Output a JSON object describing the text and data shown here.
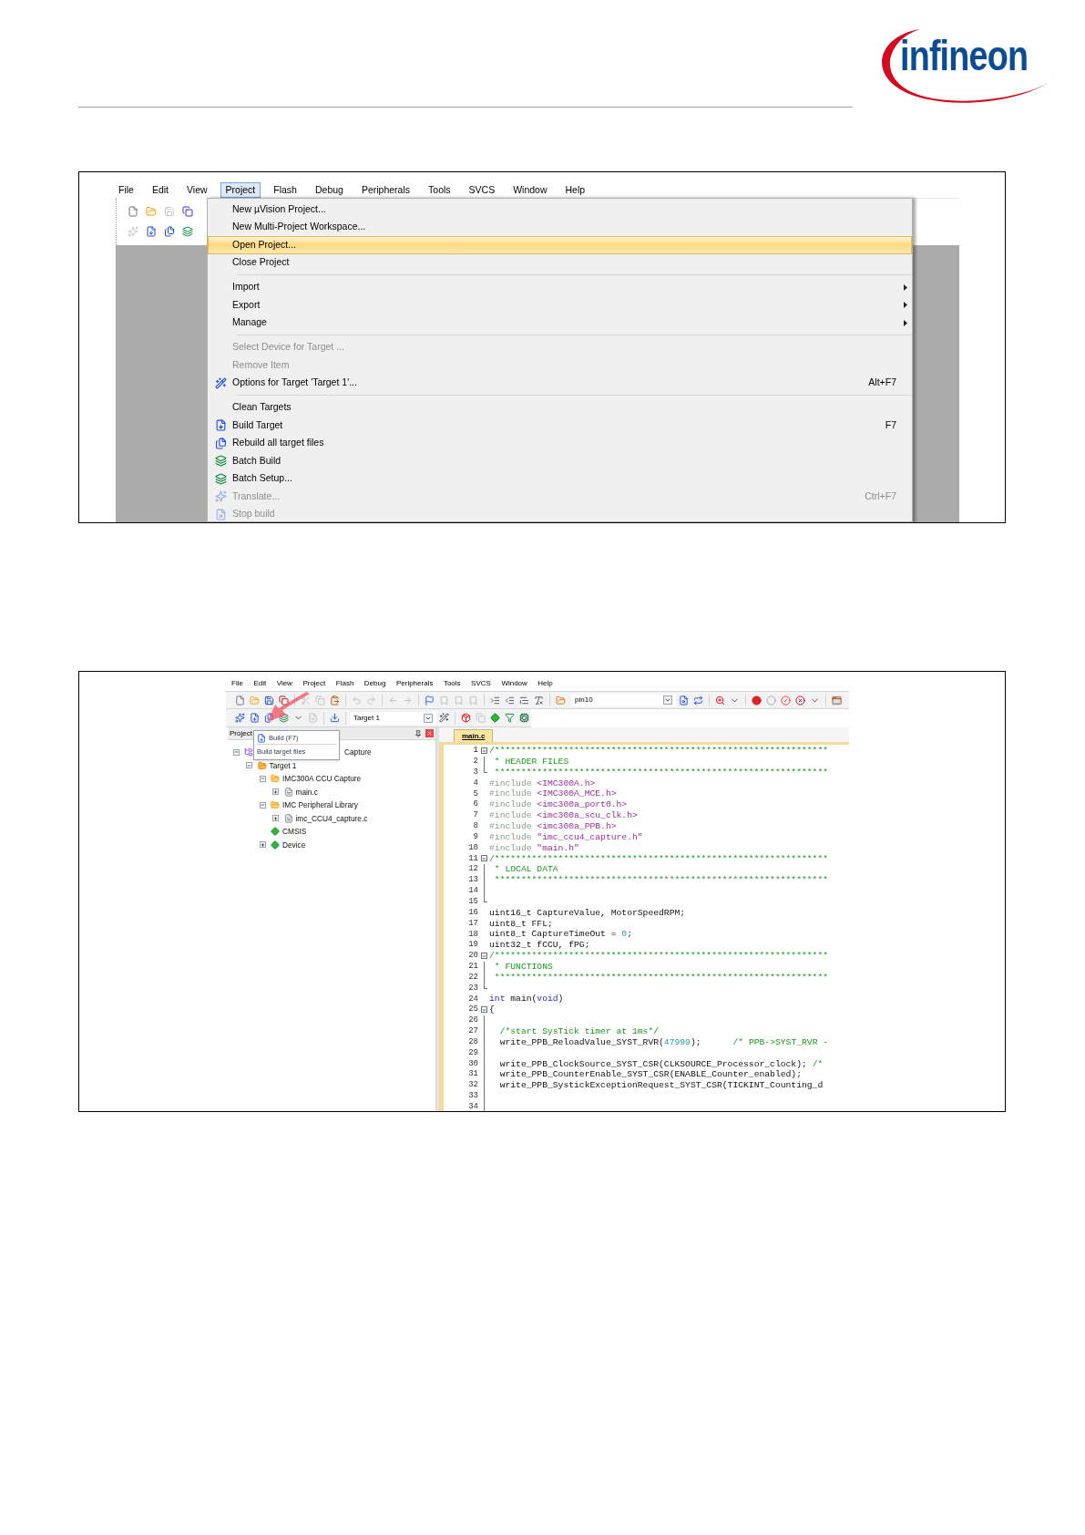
{
  "logo": {
    "text": "infineon"
  },
  "screenshot_1": {
    "menubar": [
      {
        "label": "File",
        "selected": false
      },
      {
        "label": "Edit",
        "selected": false
      },
      {
        "label": "View",
        "selected": false
      },
      {
        "label": "Project",
        "selected": true
      },
      {
        "label": "Flash",
        "selected": false
      },
      {
        "label": "Debug",
        "selected": false
      },
      {
        "label": "Peripherals",
        "selected": false
      },
      {
        "label": "Tools",
        "selected": false
      },
      {
        "label": "SVCS",
        "selected": false
      },
      {
        "label": "Window",
        "selected": false
      },
      {
        "label": "Help",
        "selected": false
      }
    ],
    "menu": [
      {
        "kind": "item",
        "label": "New µVision Project...",
        "selected": false,
        "disabled": false,
        "submenu": false
      },
      {
        "kind": "item",
        "label": "New Multi-Project Workspace...",
        "selected": false,
        "disabled": false,
        "submenu": false
      },
      {
        "kind": "item",
        "label": "Open Project...",
        "selected": true,
        "disabled": false,
        "submenu": false
      },
      {
        "kind": "item",
        "label": "Close Project",
        "selected": false,
        "disabled": false,
        "submenu": false
      },
      {
        "kind": "separator"
      },
      {
        "kind": "item",
        "label": "Import",
        "selected": false,
        "disabled": false,
        "submenu": true
      },
      {
        "kind": "item",
        "label": "Export",
        "selected": false,
        "disabled": false,
        "submenu": true
      },
      {
        "kind": "item",
        "label": "Manage",
        "selected": false,
        "disabled": false,
        "submenu": true
      },
      {
        "kind": "separator"
      },
      {
        "kind": "item",
        "label": "Select Device for Target ...",
        "selected": false,
        "disabled": true,
        "submenu": false
      },
      {
        "kind": "item",
        "label": "Remove Item",
        "selected": false,
        "disabled": true,
        "submenu": false
      },
      {
        "kind": "item",
        "label": "Options for Target 'Target 1'...",
        "shortcut": "Alt+F7",
        "selected": false,
        "disabled": false,
        "submenu": false
      },
      {
        "kind": "separator"
      },
      {
        "kind": "item",
        "label": "Clean Targets",
        "selected": false,
        "disabled": false,
        "submenu": false
      },
      {
        "kind": "item",
        "label": "Build Target",
        "shortcut": "F7",
        "selected": false,
        "disabled": false,
        "submenu": false
      },
      {
        "kind": "item",
        "label": "Rebuild all target files",
        "selected": false,
        "disabled": false,
        "submenu": false
      },
      {
        "kind": "item",
        "label": "Batch Build",
        "selected": false,
        "disabled": false,
        "submenu": false
      },
      {
        "kind": "item",
        "label": "Batch Setup...",
        "selected": false,
        "disabled": false,
        "submenu": false
      },
      {
        "kind": "item",
        "label": "Translate...",
        "shortcut": "Ctrl+F7",
        "selected": false,
        "disabled": true,
        "submenu": false
      },
      {
        "kind": "item",
        "label": "Stop build",
        "selected": false,
        "disabled": true,
        "submenu": false
      }
    ]
  },
  "screenshot_2": {
    "menubar": [
      "File",
      "Edit",
      "View",
      "Project",
      "Flash",
      "Debug",
      "Peripherals",
      "Tools",
      "SVCS",
      "Window",
      "Help"
    ],
    "toolbar": {
      "configuration": "pin10",
      "target": "Target 1"
    },
    "tooltip": {
      "title": "Build (F7)",
      "description": "Build target files"
    },
    "project_panel": {
      "title": "Project",
      "tree": [
        {
          "label": "Capture",
          "kind": "project",
          "expandable": true,
          "expanded": true,
          "children": [
            {
              "label": "Target 1",
              "kind": "target",
              "expandable": true,
              "expanded": true,
              "children": [
                {
                  "label": "IMC300A CCU Capture",
                  "kind": "folder",
                  "expandable": true,
                  "expanded": true,
                  "children": [
                    {
                      "label": "main.c",
                      "kind": "file",
                      "expandable": true,
                      "expanded": false
                    }
                  ]
                },
                {
                  "label": "IMC Peripheral Library",
                  "kind": "folder",
                  "expandable": true,
                  "expanded": true,
                  "children": [
                    {
                      "label": "imc_CCU4_capture.c",
                      "kind": "file",
                      "expandable": true,
                      "expanded": false
                    }
                  ]
                },
                {
                  "label": "CMSIS",
                  "kind": "component",
                  "expandable": false,
                  "expanded": false
                },
                {
                  "label": "Device",
                  "kind": "component",
                  "expandable": true,
                  "expanded": false
                }
              ]
            }
          ]
        }
      ]
    },
    "editor": {
      "tab": "main.c",
      "lines": [
        {
          "number": "1",
          "kind": "open",
          "parts": [
            {
              "kind": "comment",
              "text": "/***************************************************************"
            }
          ]
        },
        {
          "number": "2",
          "kind": "inner",
          "parts": [
            {
              "kind": "comment",
              "text": " * HEADER FILES"
            }
          ]
        },
        {
          "number": "3",
          "kind": "close",
          "parts": [
            {
              "kind": "comment",
              "text": " ***************************************************************"
            }
          ]
        },
        {
          "number": "4",
          "kind": "plain",
          "parts": [
            {
              "kind": "directive",
              "text": "#include "
            },
            {
              "kind": "string",
              "text": "<IMC300A.h>"
            }
          ]
        },
        {
          "number": "5",
          "kind": "plain",
          "parts": [
            {
              "kind": "directive",
              "text": "#include "
            },
            {
              "kind": "string",
              "text": "<IMC300A_MCE.h>"
            }
          ]
        },
        {
          "number": "6",
          "kind": "plain",
          "parts": [
            {
              "kind": "directive",
              "text": "#include "
            },
            {
              "kind": "string",
              "text": "<imc300a_port0.h>"
            }
          ]
        },
        {
          "number": "7",
          "kind": "plain",
          "parts": [
            {
              "kind": "directive",
              "text": "#include "
            },
            {
              "kind": "string",
              "text": "<imc300a_scu_clk.h>"
            }
          ]
        },
        {
          "number": "8",
          "kind": "plain",
          "parts": [
            {
              "kind": "directive",
              "text": "#include "
            },
            {
              "kind": "string",
              "text": "<imc300a_PPB.h>"
            }
          ]
        },
        {
          "number": "9",
          "kind": "plain",
          "parts": [
            {
              "kind": "directive",
              "text": "#include "
            },
            {
              "kind": "string",
              "text": "\"imc_ccu4_capture.h\""
            }
          ]
        },
        {
          "number": "10",
          "kind": "plain",
          "parts": [
            {
              "kind": "directive",
              "text": "#include "
            },
            {
              "kind": "string",
              "text": "\"main.h\""
            }
          ]
        },
        {
          "number": "11",
          "kind": "open",
          "parts": [
            {
              "kind": "comment",
              "text": "/***************************************************************"
            }
          ]
        },
        {
          "number": "12",
          "kind": "inner",
          "parts": [
            {
              "kind": "comment",
              "text": " * LOCAL DATA"
            }
          ]
        },
        {
          "number": "13",
          "kind": "inner",
          "parts": [
            {
              "kind": "comment",
              "text": " ***************************************************************"
            }
          ]
        },
        {
          "number": "14",
          "kind": "inner"
        },
        {
          "number": "15",
          "kind": "close"
        },
        {
          "number": "16",
          "kind": "plain",
          "parts": [
            {
              "kind": "plain",
              "text": "uint16_t CaptureValue, MotorSpeedRPM;"
            }
          ]
        },
        {
          "number": "17",
          "kind": "plain",
          "parts": [
            {
              "kind": "plain",
              "text": "uint8_t FFL;"
            }
          ]
        },
        {
          "number": "18",
          "kind": "plain",
          "parts": [
            {
              "kind": "plain",
              "text": "uint8_t CaptureTimeOut = "
            },
            {
              "kind": "number",
              "text": "0"
            },
            {
              "kind": "plain",
              "text": ";"
            }
          ]
        },
        {
          "number": "19",
          "kind": "plain",
          "parts": [
            {
              "kind": "plain",
              "text": "uint32_t fCCU, fPG;"
            }
          ]
        },
        {
          "number": "20",
          "kind": "open",
          "parts": [
            {
              "kind": "comment",
              "text": "/***************************************************************"
            }
          ]
        },
        {
          "number": "21",
          "kind": "inner",
          "parts": [
            {
              "kind": "comment",
              "text": " * FUNCTIONS"
            }
          ]
        },
        {
          "number": "22",
          "kind": "inner",
          "parts": [
            {
              "kind": "comment",
              "text": " ***************************************************************"
            }
          ]
        },
        {
          "number": "23",
          "kind": "close"
        },
        {
          "number": "24",
          "kind": "plain",
          "parts": [
            {
              "kind": "keyword",
              "text": "int"
            },
            {
              "kind": "plain",
              "text": " main("
            },
            {
              "kind": "keyword",
              "text": "void"
            },
            {
              "kind": "plain",
              "text": ")"
            }
          ]
        },
        {
          "number": "25",
          "kind": "open",
          "parts": [
            {
              "kind": "plain",
              "text": "{"
            }
          ]
        },
        {
          "number": "26",
          "kind": "inner"
        },
        {
          "number": "27",
          "kind": "inner",
          "parts": [
            {
              "kind": "comment",
              "text": "  /*start SysTick timer at 1ms*/"
            }
          ]
        },
        {
          "number": "28",
          "kind": "inner",
          "parts": [
            {
              "kind": "plain",
              "text": "  write_PPB_ReloadValue_SYST_RVR("
            },
            {
              "kind": "number",
              "text": "47999"
            },
            {
              "kind": "plain",
              "text": ");      "
            },
            {
              "kind": "comment",
              "text": "/* PPB->SYST_RVR -"
            }
          ]
        },
        {
          "number": "29",
          "kind": "inner"
        },
        {
          "number": "30",
          "kind": "inner",
          "parts": [
            {
              "kind": "plain",
              "text": "  write_PPB_ClockSource_SYST_CSR(CLKSOURCE_Processor_clock); "
            },
            {
              "kind": "comment",
              "text": "/*"
            }
          ]
        },
        {
          "number": "31",
          "kind": "inner",
          "parts": [
            {
              "kind": "plain",
              "text": "  write_PPB_CounterEnable_SYST_CSR(ENABLE_Counter_enabled);"
            }
          ]
        },
        {
          "number": "32",
          "kind": "inner",
          "parts": [
            {
              "kind": "plain",
              "text": "  write_PPB_SystickExceptionRequest_SYST_CSR(TICKINT_Counting_d"
            }
          ]
        },
        {
          "number": "33",
          "kind": "inner"
        },
        {
          "number": "34",
          "kind": "inner"
        }
      ]
    }
  }
}
